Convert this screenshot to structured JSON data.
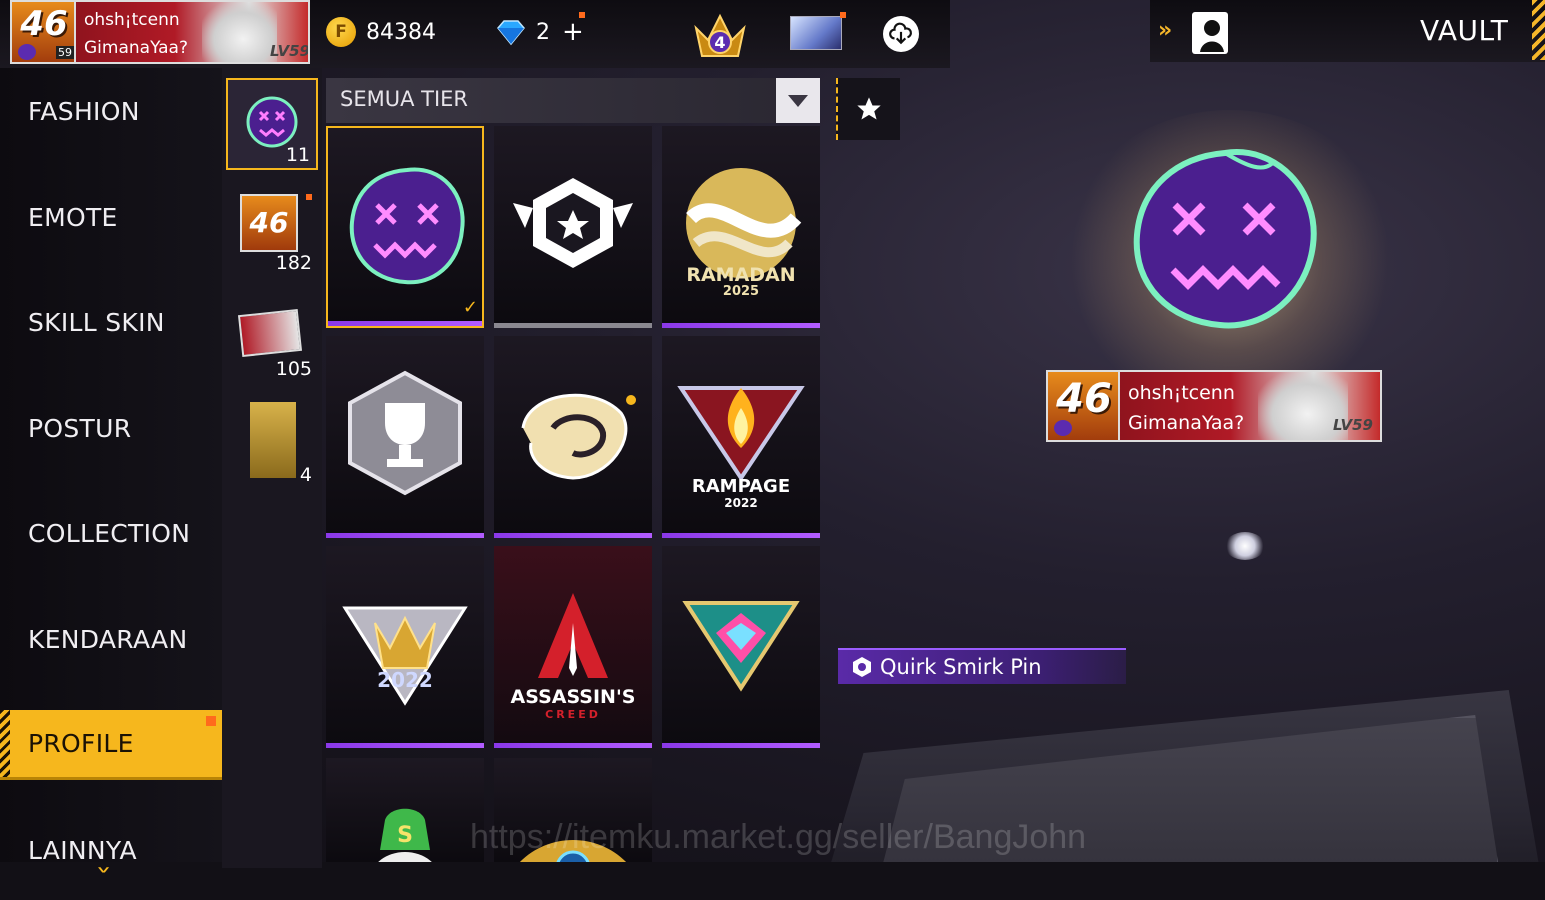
{
  "player": {
    "level": "46",
    "badge_sub": "59",
    "name": "ohsh¡tcenn",
    "signature": "GimanaYaa?",
    "lv_tag": "LV59"
  },
  "currency": {
    "gold": "84384",
    "diamonds": "2",
    "plus": "+"
  },
  "crown_rank": "4",
  "vault": {
    "title": "VAULT"
  },
  "menu": {
    "items": [
      {
        "label": "FASHION"
      },
      {
        "label": "EMOTE"
      },
      {
        "label": "SKILL SKIN"
      },
      {
        "label": "POSTUR"
      },
      {
        "label": "COLLECTION"
      },
      {
        "label": "KENDARAAN"
      },
      {
        "label": "PROFILE"
      },
      {
        "label": "LAINNYA"
      }
    ],
    "active": "PROFILE"
  },
  "categories": [
    {
      "icon": "pin-icon",
      "count": "11"
    },
    {
      "icon": "avatar-icon",
      "count": "182"
    },
    {
      "icon": "banner-icon",
      "count": "105"
    },
    {
      "icon": "character-icon",
      "count": "4"
    }
  ],
  "filter": {
    "label": "SEMUA TIER"
  },
  "grid": {
    "items": [
      {
        "name": "quirk-smirk-pin",
        "text": ""
      },
      {
        "name": "star-badge-pin",
        "text": ""
      },
      {
        "name": "ramadan-pin",
        "text": "RAMADAN",
        "sub": "2025"
      },
      {
        "name": "trophy-pin",
        "text": ""
      },
      {
        "name": "swirl-pin",
        "text": ""
      },
      {
        "name": "rampage-pin",
        "text": "RAMPAGE",
        "sub": "2022"
      },
      {
        "name": "crown-2022-pin",
        "text": "2022"
      },
      {
        "name": "assassins-creed-pin",
        "text": "ASSASSIN'S",
        "sub": "CREED"
      },
      {
        "name": "gem-triangle-pin",
        "text": ""
      },
      {
        "name": "money-skull-pin",
        "text": ""
      },
      {
        "name": "gold-eye-pin",
        "text": ""
      }
    ]
  },
  "preview": {
    "item_name": "Quirk Smirk Pin"
  },
  "watermark": "https://itemku.market.gg/seller/BangJohn",
  "colors": {
    "accent": "#f6b71d",
    "rarity_purple": "#9b5cff"
  }
}
